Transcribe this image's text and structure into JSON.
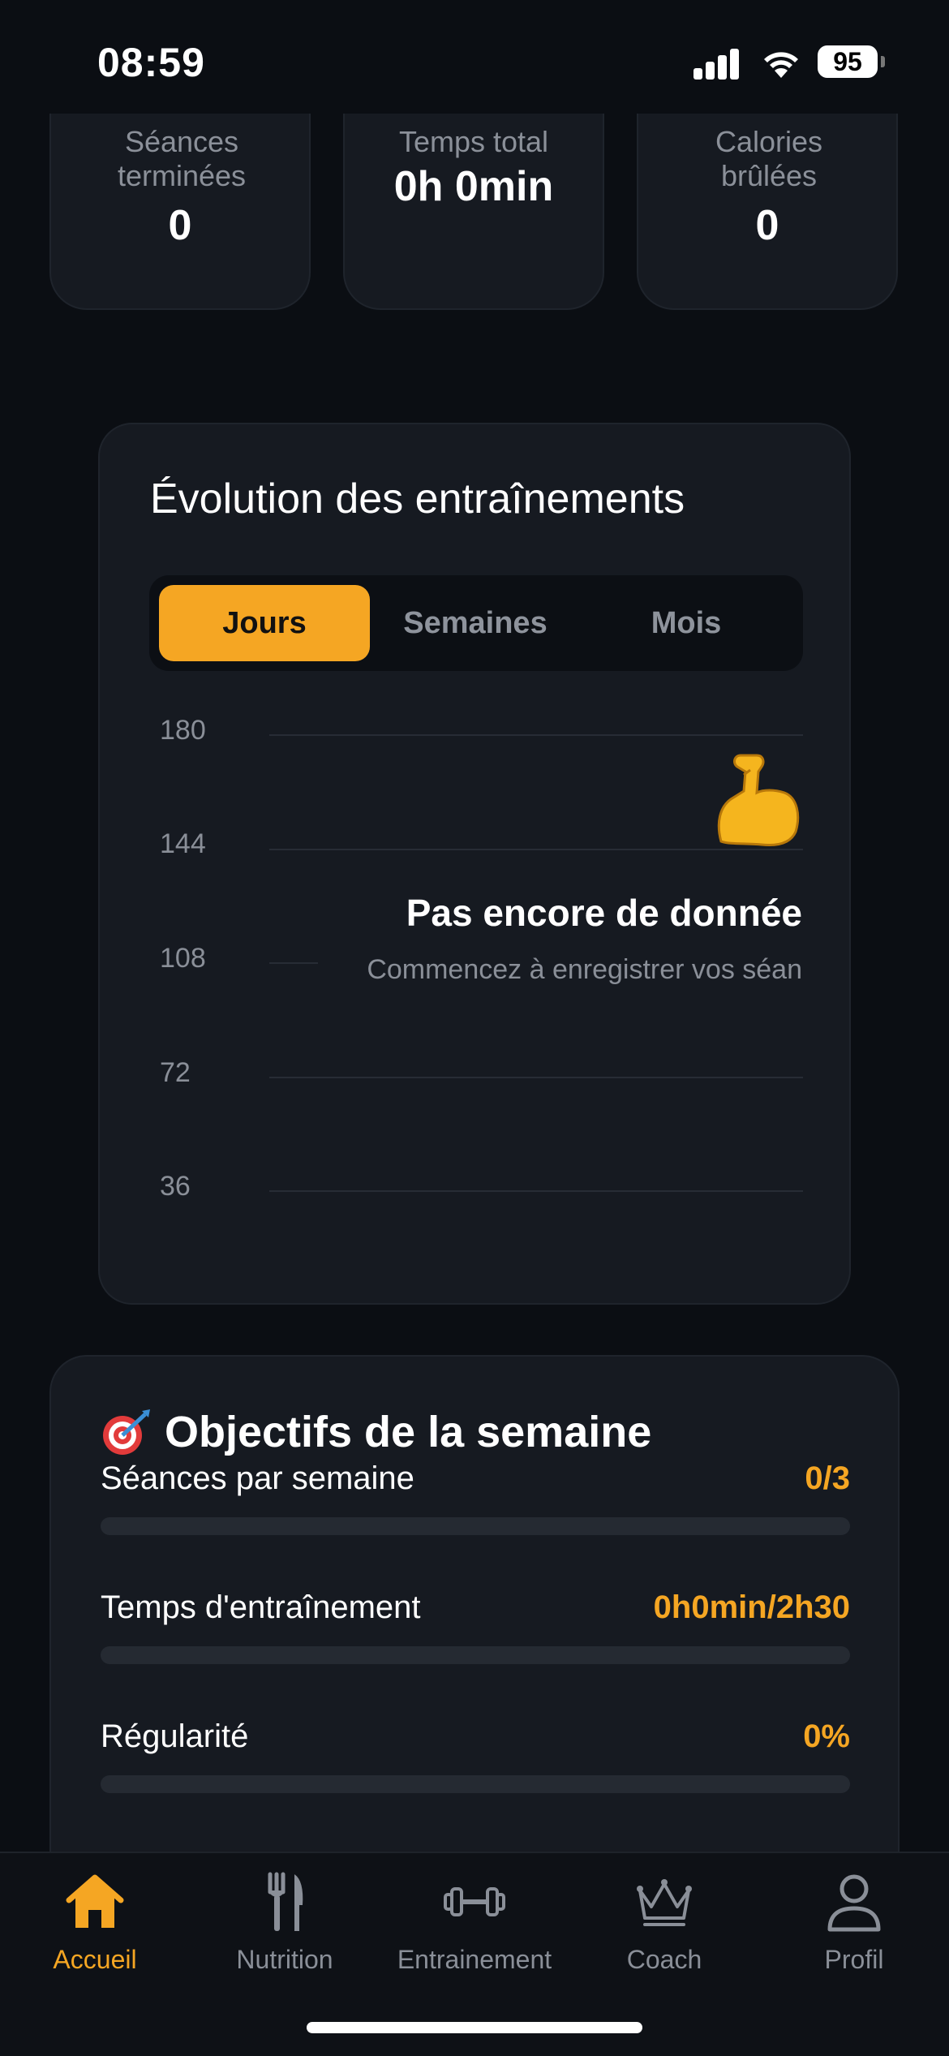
{
  "status_bar": {
    "time": "08:59",
    "battery": "95"
  },
  "stats": [
    {
      "label": "Séances terminées",
      "value": "0"
    },
    {
      "label": "Temps total",
      "value": "0h 0min"
    },
    {
      "label": "Calories brûlées",
      "value": "0"
    }
  ],
  "chart": {
    "title": "Évolution des entraînements",
    "tabs": [
      "Jours",
      "Semaines",
      "Mois"
    ],
    "active_tab": "Jours",
    "empty_title": "Pas encore de donnée",
    "empty_subtitle": "Commencez à enregistrer vos séan",
    "empty_icon": "flexed-biceps-icon"
  },
  "chart_data": {
    "type": "line",
    "title": "Évolution des entraînements",
    "y_ticks": [
      180,
      144,
      108,
      72,
      36
    ],
    "ylim": [
      36,
      180
    ],
    "series": [],
    "grid": true
  },
  "goals": {
    "title": "Objectifs de la semaine",
    "icon": "target-icon",
    "items": [
      {
        "label": "Séances par semaine",
        "value": "0/3",
        "progress": 0
      },
      {
        "label": "Temps d'entraînement",
        "value": "0h0min/2h30",
        "progress": 0
      },
      {
        "label": "Régularité",
        "value": "0%",
        "progress": 0
      }
    ]
  },
  "tabbar": {
    "items": [
      {
        "label": "Accueil",
        "icon": "home-icon",
        "active": true
      },
      {
        "label": "Nutrition",
        "icon": "fork-knife-icon",
        "active": false
      },
      {
        "label": "Entrainement",
        "icon": "dumbbell-icon",
        "active": false
      },
      {
        "label": "Coach",
        "icon": "crown-icon",
        "active": false
      },
      {
        "label": "Profil",
        "icon": "user-icon",
        "active": false
      }
    ]
  },
  "colors": {
    "accent": "#f5a623",
    "background": "#0b0e13",
    "card": "#161a21",
    "muted": "#8a8f98"
  }
}
